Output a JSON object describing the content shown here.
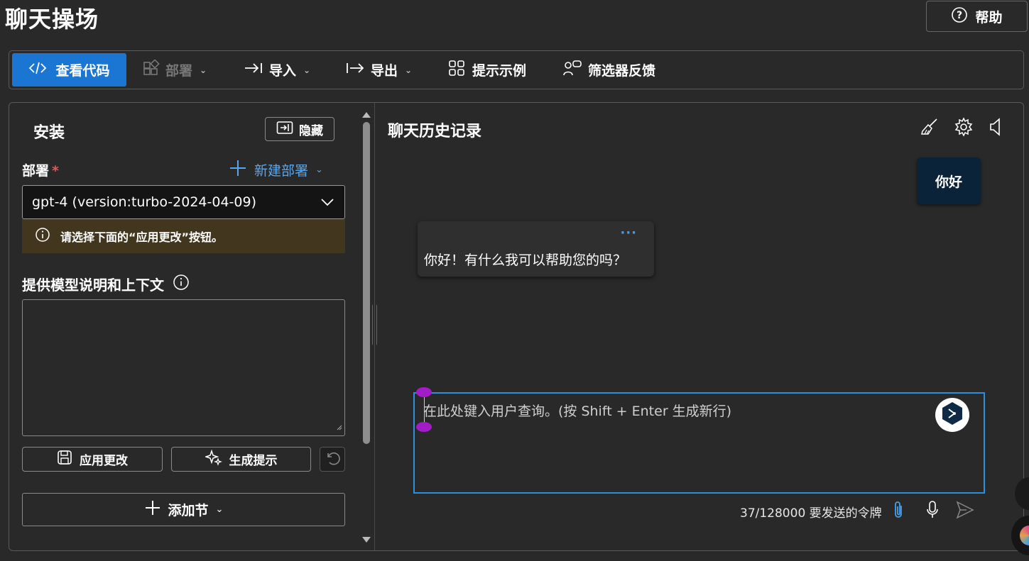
{
  "page": {
    "title": "聊天操场",
    "help_label": "帮助"
  },
  "toolbar": {
    "view_code": "查看代码",
    "deploy": "部署",
    "import": "导入",
    "export": "导出",
    "prompt_samples": "提示示例",
    "filter_feedback": "筛选器反馈"
  },
  "setup": {
    "title": "安装",
    "hide_label": "隐藏",
    "deployment_label": "部署",
    "required_mark": "*",
    "new_deployment": "新建部署",
    "deployment_value": "gpt-4 (version:turbo-2024-04-09)",
    "warning": "请选择下面的“应用更改”按钮。",
    "system_message_label": "提供模型说明和上下文",
    "apply_changes": "应用更改",
    "generate_prompt": "生成提示",
    "add_section": "添加节"
  },
  "chat": {
    "title": "聊天历史记录",
    "messages": [
      {
        "role": "user",
        "text": "你好"
      },
      {
        "role": "assistant",
        "text": "你好！有什么我可以帮助您的吗？",
        "more": "···"
      }
    ],
    "input_placeholder": "在此处键入用户查询。(按 Shift + Enter 生成新行)",
    "token_count": "37/128000 要发送的令牌"
  },
  "colors": {
    "accent": "#1a76d2",
    "link": "#5aa6ec",
    "warning_bg": "#43361e",
    "user_bubble": "#0b2339",
    "input_border": "#2d8fe0"
  },
  "icons": [
    "code-icon",
    "deploy-icon",
    "import-icon",
    "export-icon",
    "grid-icon",
    "feedback-icon",
    "help-icon",
    "hide-panel-icon",
    "plus-icon",
    "chevron-down-icon",
    "info-icon",
    "save-icon",
    "sparkle-icon",
    "undo-icon",
    "broom-icon",
    "gear-icon",
    "speaker-icon",
    "assist-icon",
    "paperclip-icon",
    "microphone-icon",
    "send-icon"
  ]
}
